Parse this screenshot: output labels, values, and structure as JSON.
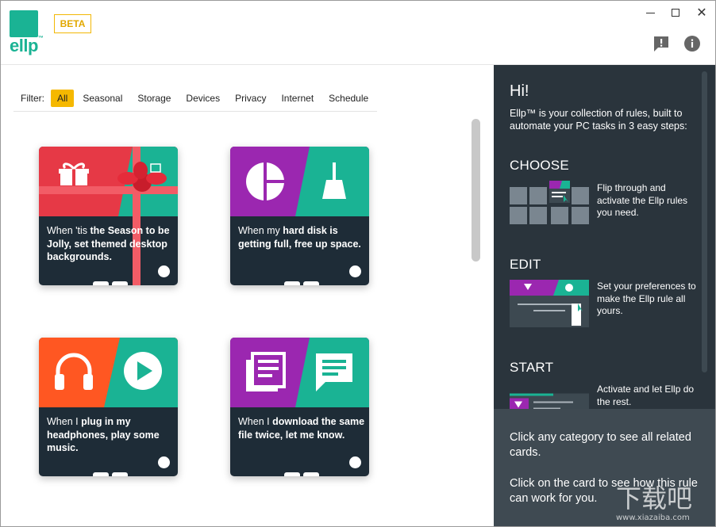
{
  "app": {
    "logo_text": "ellp",
    "logo_tm": "™",
    "beta_label": "BETA",
    "brand_color": "#1ab394",
    "accent_color": "#f5b800"
  },
  "window_controls": {
    "minimize_icon": "minimize-icon",
    "maximize_icon": "maximize-icon",
    "close_icon": "close-icon",
    "close_glyph": "✕"
  },
  "header_icons": {
    "feedback_icon": "feedback-icon",
    "info_icon": "info-icon"
  },
  "filter": {
    "label": "Filter:",
    "items": [
      "All",
      "Seasonal",
      "Storage",
      "Devices",
      "Privacy",
      "Internet",
      "Schedule"
    ],
    "selected": "All"
  },
  "cards": [
    {
      "pre": "When 'tis ",
      "bold": "the Season to be Jolly, set themed desktop backgrounds.",
      "post": "",
      "left_color": "#e63946",
      "right_color": "#1ab394",
      "icon": "gift-icon"
    },
    {
      "pre": "When my ",
      "bold": "hard disk is getting full, free up space.",
      "post": "",
      "left_color": "#9b27b0",
      "right_color": "#1ab394",
      "icon": "pie-chart-icon"
    },
    {
      "pre": "When I ",
      "bold": "plug in my headphones, play some music.",
      "post": "",
      "left_color": "#ff5722",
      "right_color": "#1ab394",
      "icon": "headphones-icon"
    },
    {
      "pre": "When I ",
      "bold": "download the same file twice, let me know.",
      "post": "",
      "left_color": "#9b27b0",
      "right_color": "#1ab394",
      "icon": "newspaper-icon"
    }
  ],
  "right_panel": {
    "greeting": "Hi!",
    "intro": "Ellp™ is your collection of rules, built to automate your PC tasks in 3 easy steps:",
    "steps": [
      {
        "heading": "CHOOSE",
        "desc": "Flip through and activate the Ellp rules you need."
      },
      {
        "heading": "EDIT",
        "desc": "Set your preferences to make the Ellp rule all yours."
      },
      {
        "heading": "START",
        "desc": "Activate and let Ellp do the rest."
      }
    ],
    "bottom_tips": [
      "Click any category to see all related cards.",
      "Click on the card to see how this rule can work for you."
    ]
  },
  "watermark": {
    "text_top": "下载吧",
    "text_bottom": "www.xiazaiba.com"
  }
}
